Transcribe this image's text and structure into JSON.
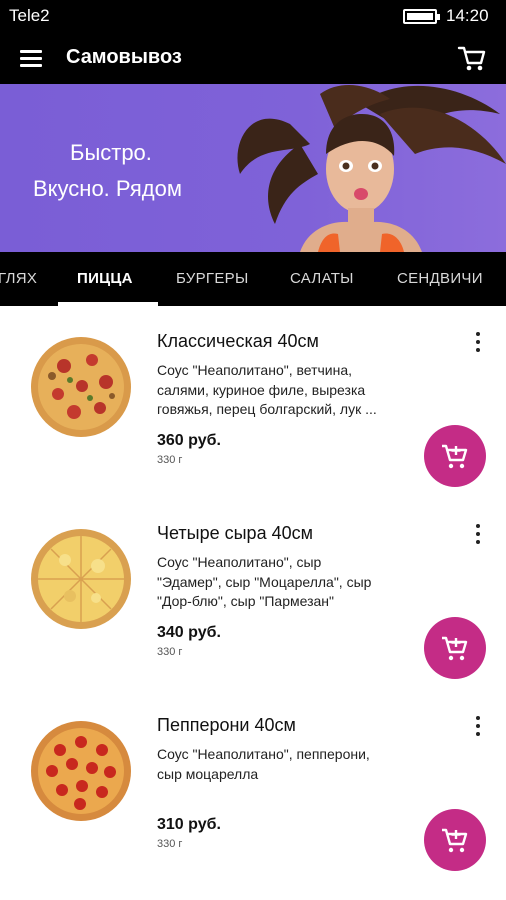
{
  "status_bar": {
    "carrier": "Tele2",
    "time": "14:20"
  },
  "app_bar": {
    "title": "Самовывоз",
    "menu_icon": "hamburger-menu-icon",
    "cart_icon": "shopping-cart-icon"
  },
  "banner": {
    "line1": "Быстро.",
    "line2": "Вкусно. Рядом",
    "accent_color": "#7f62d8"
  },
  "tabs": [
    {
      "label": "ГЛЯХ"
    },
    {
      "label": "ПИЦЦА",
      "active": true
    },
    {
      "label": "БУРГЕРЫ"
    },
    {
      "label": "САЛАТЫ"
    },
    {
      "label": "СЕНДВИЧИ"
    }
  ],
  "products": [
    {
      "name": "Классическая 40см",
      "description_lines": [
        "Соус \"Неаполитано\", ветчина,",
        "салями, куриное филе, вырезка",
        "говяжья, перец болгарский, лук ..."
      ],
      "price": "360 руб.",
      "weight": "330 г"
    },
    {
      "name": "Четыре сыра 40см",
      "description_lines": [
        "Соус \"Неаполитано\", сыр",
        "\"Эдамер\", сыр \"Моцарелла\", сыр",
        "\"Дор-блю\", сыр \"Пармезан\""
      ],
      "price": "340 руб.",
      "weight": "330 г"
    },
    {
      "name": "Пепперони 40см",
      "description_lines": [
        "Соус \"Неаполитано\", пепперони,",
        "сыр моцарелла"
      ],
      "price": "310 руб.",
      "weight": "330 г"
    }
  ],
  "colors": {
    "add_button": "#c42c86",
    "bars": "#000000"
  }
}
